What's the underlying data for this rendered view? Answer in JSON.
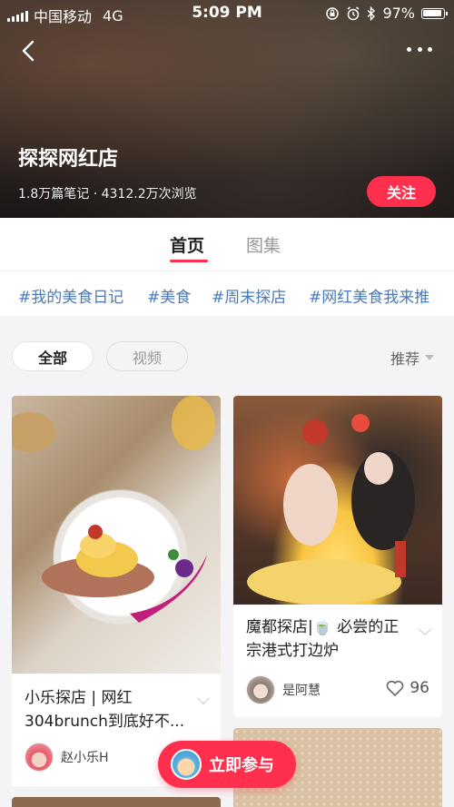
{
  "status_bar": {
    "carrier": "中国移动",
    "network": "4G",
    "time": "5:09 PM",
    "battery": "97%"
  },
  "header": {
    "title": "探探网红店",
    "stats": "1.8万篇笔记 · 4312.2万次浏览",
    "follow_label": "关注"
  },
  "tabs": [
    {
      "label": "首页",
      "active": true
    },
    {
      "label": "图集",
      "active": false
    }
  ],
  "hashtags": [
    "#我的美食日记",
    "#美食",
    "#周末探店",
    "#网红美食我来推"
  ],
  "filters": {
    "chips": [
      {
        "label": "全部",
        "active": true
      },
      {
        "label": "视频",
        "active": false
      }
    ],
    "sort_label": "推荐"
  },
  "cards": [
    {
      "title": "小乐探店 | 网红304brunch到底好不...",
      "author": "赵小乐H",
      "image": "food-plate-photo"
    },
    {
      "title": "魔都探店|🍵 必尝的正宗港式打边炉",
      "author": "是阿慧",
      "likes": "96",
      "image": "street-hotpot-photo"
    }
  ],
  "join_button": {
    "label": "立即参与"
  },
  "colors": {
    "accent": "#ff2f4d",
    "hashtag": "#4a7bb7"
  }
}
